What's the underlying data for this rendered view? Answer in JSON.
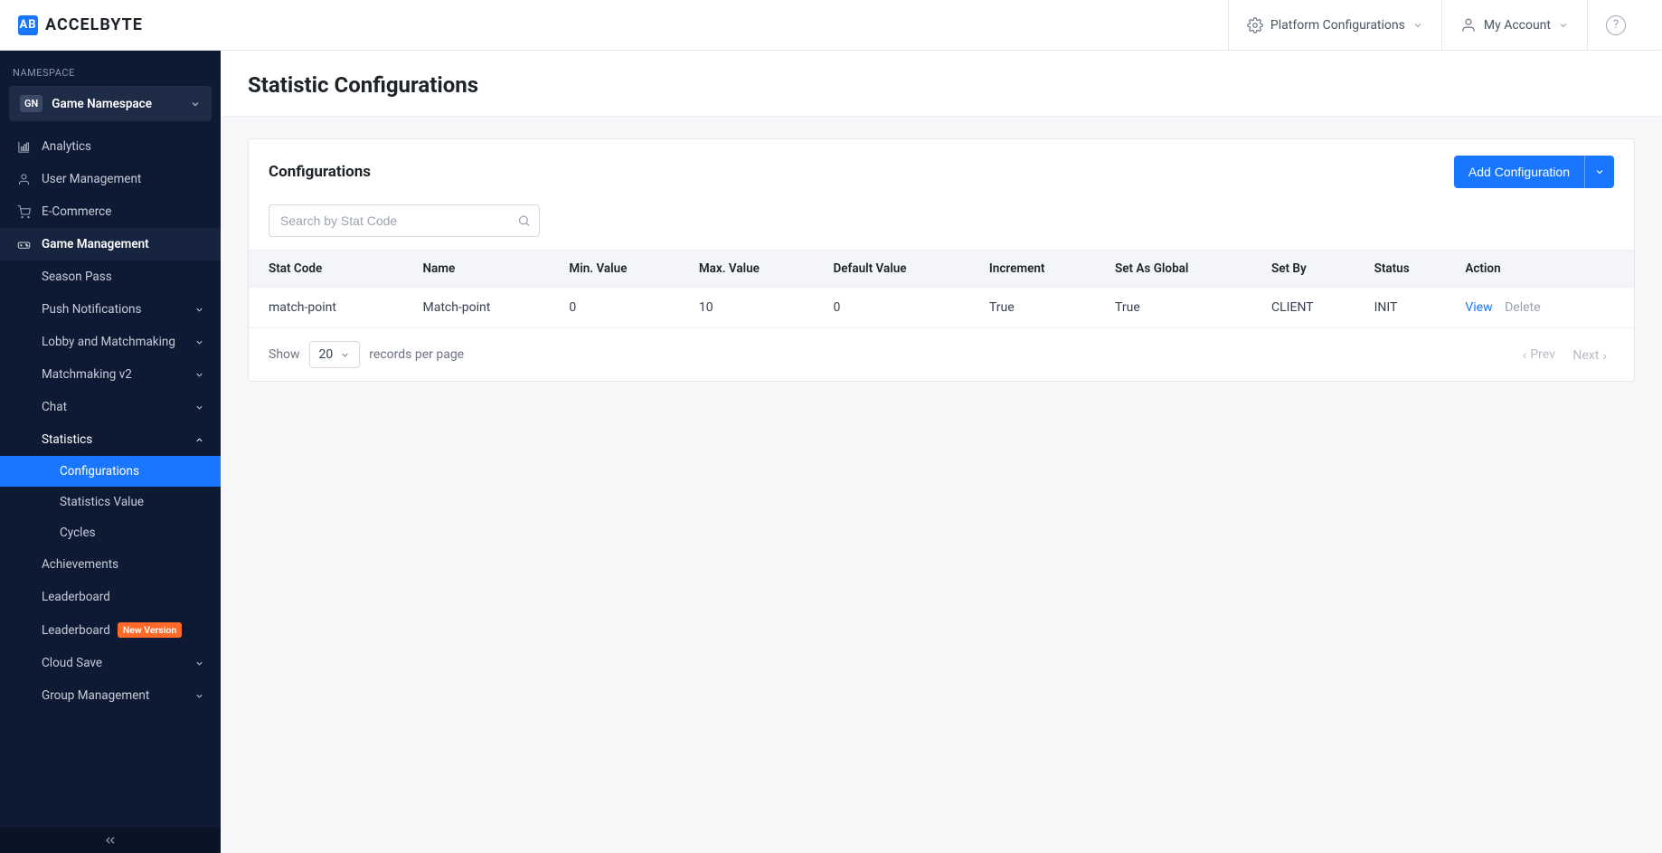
{
  "brand": {
    "logo_text": "AB",
    "name": "ACCELBYTE"
  },
  "topbar": {
    "platform_config": "Platform Configurations",
    "my_account": "My Account"
  },
  "sidebar": {
    "namespace_label": "NAMESPACE",
    "namespace_badge": "GN",
    "namespace_name": "Game Namespace",
    "items": {
      "analytics": "Analytics",
      "user_management": "User Management",
      "ecommerce": "E-Commerce",
      "game_management": "Game Management"
    },
    "game_mgmt": {
      "season_pass": "Season Pass",
      "push_notifications": "Push Notifications",
      "lobby_matchmaking": "Lobby and Matchmaking",
      "matchmaking_v2": "Matchmaking v2",
      "chat": "Chat",
      "statistics": "Statistics",
      "statistics_children": {
        "configurations": "Configurations",
        "statistics_value": "Statistics Value",
        "cycles": "Cycles"
      },
      "achievements": "Achievements",
      "leaderboard": "Leaderboard",
      "leaderboard_new": "Leaderboard",
      "leaderboard_new_badge": "New Version",
      "cloud_save": "Cloud Save",
      "group_management": "Group Management"
    }
  },
  "page": {
    "title": "Statistic Configurations"
  },
  "panel": {
    "title": "Configurations",
    "add_button": "Add Configuration",
    "search_placeholder": "Search by Stat Code"
  },
  "table": {
    "headers": {
      "stat_code": "Stat Code",
      "name": "Name",
      "min_value": "Min. Value",
      "max_value": "Max. Value",
      "default_value": "Default Value",
      "increment": "Increment",
      "set_as_global": "Set As Global",
      "set_by": "Set By",
      "status": "Status",
      "action": "Action"
    },
    "rows": [
      {
        "stat_code": "match-point",
        "name": "Match-point",
        "min_value": "0",
        "max_value": "10",
        "default_value": "0",
        "increment": "True",
        "set_as_global": "True",
        "set_by": "CLIENT",
        "status": "INIT"
      }
    ],
    "actions": {
      "view": "View",
      "delete": "Delete"
    }
  },
  "footer": {
    "show": "Show",
    "page_size": "20",
    "records_per_page": "records per page",
    "prev": "Prev",
    "next": "Next"
  }
}
